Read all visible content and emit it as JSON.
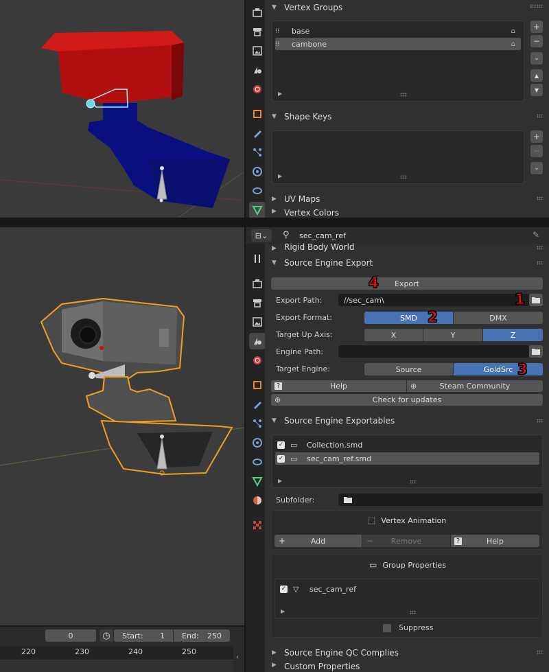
{
  "top_props": {
    "vertex_groups": {
      "title": "Vertex Groups",
      "items": [
        {
          "name": "base",
          "selected": false
        },
        {
          "name": "cambone",
          "selected": true
        }
      ]
    },
    "shape_keys": {
      "title": "Shape Keys"
    },
    "uv_maps": {
      "title": "UV Maps"
    },
    "vertex_colors": {
      "title": "Vertex Colors"
    }
  },
  "bottom_props": {
    "header": {
      "object_name": "sec_cam_ref"
    },
    "rigid_body_world": "Rigid Body World",
    "source_engine_export": {
      "title": "Source Engine Export",
      "export_button": "Export",
      "export_path_label": "Export Path:",
      "export_path_value": "//sec_cam\\",
      "export_format_label": "Export Format:",
      "export_formats": [
        {
          "label": "SMD",
          "active": true
        },
        {
          "label": "DMX",
          "active": false
        }
      ],
      "up_axis_label": "Target Up Axis:",
      "up_axes": [
        {
          "label": "X",
          "active": false
        },
        {
          "label": "Y",
          "active": false
        },
        {
          "label": "Z",
          "active": true
        }
      ],
      "engine_path_label": "Engine Path:",
      "engine_path_value": "",
      "target_engine_label": "Target Engine:",
      "target_engines": [
        {
          "label": "Source",
          "active": false
        },
        {
          "label": "GoldSrc",
          "active": true
        }
      ],
      "help_button": "Help",
      "steam_button": "Steam Community",
      "updates_button": "Check for updates"
    },
    "exportables": {
      "title": "Source Engine Exportables",
      "items": [
        {
          "name": "Collection.smd",
          "checked": true,
          "selected": false
        },
        {
          "name": "sec_cam_ref.smd",
          "checked": true,
          "selected": true
        }
      ],
      "subfolder_label": "Subfolder:",
      "subfolder_value": "",
      "vertex_animation": {
        "title": "Vertex Animation",
        "add": "Add",
        "remove": "Remove",
        "help": "Help"
      },
      "group_properties": {
        "title": "Group Properties",
        "items": [
          {
            "name": "sec_cam_ref",
            "checked": true
          }
        ],
        "suppress_label": "Suppress"
      }
    },
    "qc_complies": {
      "title": "Source Engine QC Complies"
    },
    "custom_properties": {
      "title": "Custom Properties"
    }
  },
  "timeline": {
    "current_frame": "0",
    "start_label": "Start:",
    "start_value": "1",
    "end_label": "End:",
    "end_value": "250",
    "ruler_labels": [
      "220",
      "230",
      "240",
      "250"
    ]
  },
  "annotations": [
    "1",
    "2",
    "3",
    "4"
  ],
  "colors": {
    "accent_blue": "#4772b3",
    "selection_orange": "#f0a020",
    "annotation_red": "#e01010"
  },
  "icons": [
    "tool-icon",
    "render-icon",
    "output-icon",
    "view-layer-icon",
    "scene-icon",
    "world-icon",
    "object-icon",
    "modifier-icon",
    "particles-icon",
    "physics-icon",
    "constraints-icon",
    "data-icon",
    "material-icon",
    "texture-icon"
  ]
}
